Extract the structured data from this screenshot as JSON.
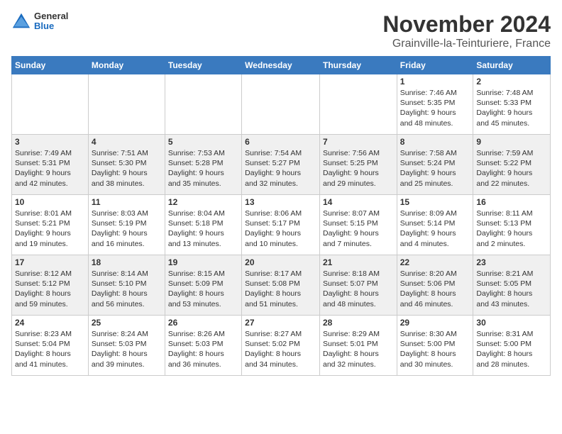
{
  "header": {
    "logo_general": "General",
    "logo_blue": "Blue",
    "month": "November 2024",
    "location": "Grainville-la-Teinturiere, France"
  },
  "weekdays": [
    "Sunday",
    "Monday",
    "Tuesday",
    "Wednesday",
    "Thursday",
    "Friday",
    "Saturday"
  ],
  "weeks": [
    [
      {
        "day": "",
        "info": ""
      },
      {
        "day": "",
        "info": ""
      },
      {
        "day": "",
        "info": ""
      },
      {
        "day": "",
        "info": ""
      },
      {
        "day": "",
        "info": ""
      },
      {
        "day": "1",
        "info": "Sunrise: 7:46 AM\nSunset: 5:35 PM\nDaylight: 9 hours\nand 48 minutes."
      },
      {
        "day": "2",
        "info": "Sunrise: 7:48 AM\nSunset: 5:33 PM\nDaylight: 9 hours\nand 45 minutes."
      }
    ],
    [
      {
        "day": "3",
        "info": "Sunrise: 7:49 AM\nSunset: 5:31 PM\nDaylight: 9 hours\nand 42 minutes."
      },
      {
        "day": "4",
        "info": "Sunrise: 7:51 AM\nSunset: 5:30 PM\nDaylight: 9 hours\nand 38 minutes."
      },
      {
        "day": "5",
        "info": "Sunrise: 7:53 AM\nSunset: 5:28 PM\nDaylight: 9 hours\nand 35 minutes."
      },
      {
        "day": "6",
        "info": "Sunrise: 7:54 AM\nSunset: 5:27 PM\nDaylight: 9 hours\nand 32 minutes."
      },
      {
        "day": "7",
        "info": "Sunrise: 7:56 AM\nSunset: 5:25 PM\nDaylight: 9 hours\nand 29 minutes."
      },
      {
        "day": "8",
        "info": "Sunrise: 7:58 AM\nSunset: 5:24 PM\nDaylight: 9 hours\nand 25 minutes."
      },
      {
        "day": "9",
        "info": "Sunrise: 7:59 AM\nSunset: 5:22 PM\nDaylight: 9 hours\nand 22 minutes."
      }
    ],
    [
      {
        "day": "10",
        "info": "Sunrise: 8:01 AM\nSunset: 5:21 PM\nDaylight: 9 hours\nand 19 minutes."
      },
      {
        "day": "11",
        "info": "Sunrise: 8:03 AM\nSunset: 5:19 PM\nDaylight: 9 hours\nand 16 minutes."
      },
      {
        "day": "12",
        "info": "Sunrise: 8:04 AM\nSunset: 5:18 PM\nDaylight: 9 hours\nand 13 minutes."
      },
      {
        "day": "13",
        "info": "Sunrise: 8:06 AM\nSunset: 5:17 PM\nDaylight: 9 hours\nand 10 minutes."
      },
      {
        "day": "14",
        "info": "Sunrise: 8:07 AM\nSunset: 5:15 PM\nDaylight: 9 hours\nand 7 minutes."
      },
      {
        "day": "15",
        "info": "Sunrise: 8:09 AM\nSunset: 5:14 PM\nDaylight: 9 hours\nand 4 minutes."
      },
      {
        "day": "16",
        "info": "Sunrise: 8:11 AM\nSunset: 5:13 PM\nDaylight: 9 hours\nand 2 minutes."
      }
    ],
    [
      {
        "day": "17",
        "info": "Sunrise: 8:12 AM\nSunset: 5:12 PM\nDaylight: 8 hours\nand 59 minutes."
      },
      {
        "day": "18",
        "info": "Sunrise: 8:14 AM\nSunset: 5:10 PM\nDaylight: 8 hours\nand 56 minutes."
      },
      {
        "day": "19",
        "info": "Sunrise: 8:15 AM\nSunset: 5:09 PM\nDaylight: 8 hours\nand 53 minutes."
      },
      {
        "day": "20",
        "info": "Sunrise: 8:17 AM\nSunset: 5:08 PM\nDaylight: 8 hours\nand 51 minutes."
      },
      {
        "day": "21",
        "info": "Sunrise: 8:18 AM\nSunset: 5:07 PM\nDaylight: 8 hours\nand 48 minutes."
      },
      {
        "day": "22",
        "info": "Sunrise: 8:20 AM\nSunset: 5:06 PM\nDaylight: 8 hours\nand 46 minutes."
      },
      {
        "day": "23",
        "info": "Sunrise: 8:21 AM\nSunset: 5:05 PM\nDaylight: 8 hours\nand 43 minutes."
      }
    ],
    [
      {
        "day": "24",
        "info": "Sunrise: 8:23 AM\nSunset: 5:04 PM\nDaylight: 8 hours\nand 41 minutes."
      },
      {
        "day": "25",
        "info": "Sunrise: 8:24 AM\nSunset: 5:03 PM\nDaylight: 8 hours\nand 39 minutes."
      },
      {
        "day": "26",
        "info": "Sunrise: 8:26 AM\nSunset: 5:03 PM\nDaylight: 8 hours\nand 36 minutes."
      },
      {
        "day": "27",
        "info": "Sunrise: 8:27 AM\nSunset: 5:02 PM\nDaylight: 8 hours\nand 34 minutes."
      },
      {
        "day": "28",
        "info": "Sunrise: 8:29 AM\nSunset: 5:01 PM\nDaylight: 8 hours\nand 32 minutes."
      },
      {
        "day": "29",
        "info": "Sunrise: 8:30 AM\nSunset: 5:00 PM\nDaylight: 8 hours\nand 30 minutes."
      },
      {
        "day": "30",
        "info": "Sunrise: 8:31 AM\nSunset: 5:00 PM\nDaylight: 8 hours\nand 28 minutes."
      }
    ]
  ]
}
